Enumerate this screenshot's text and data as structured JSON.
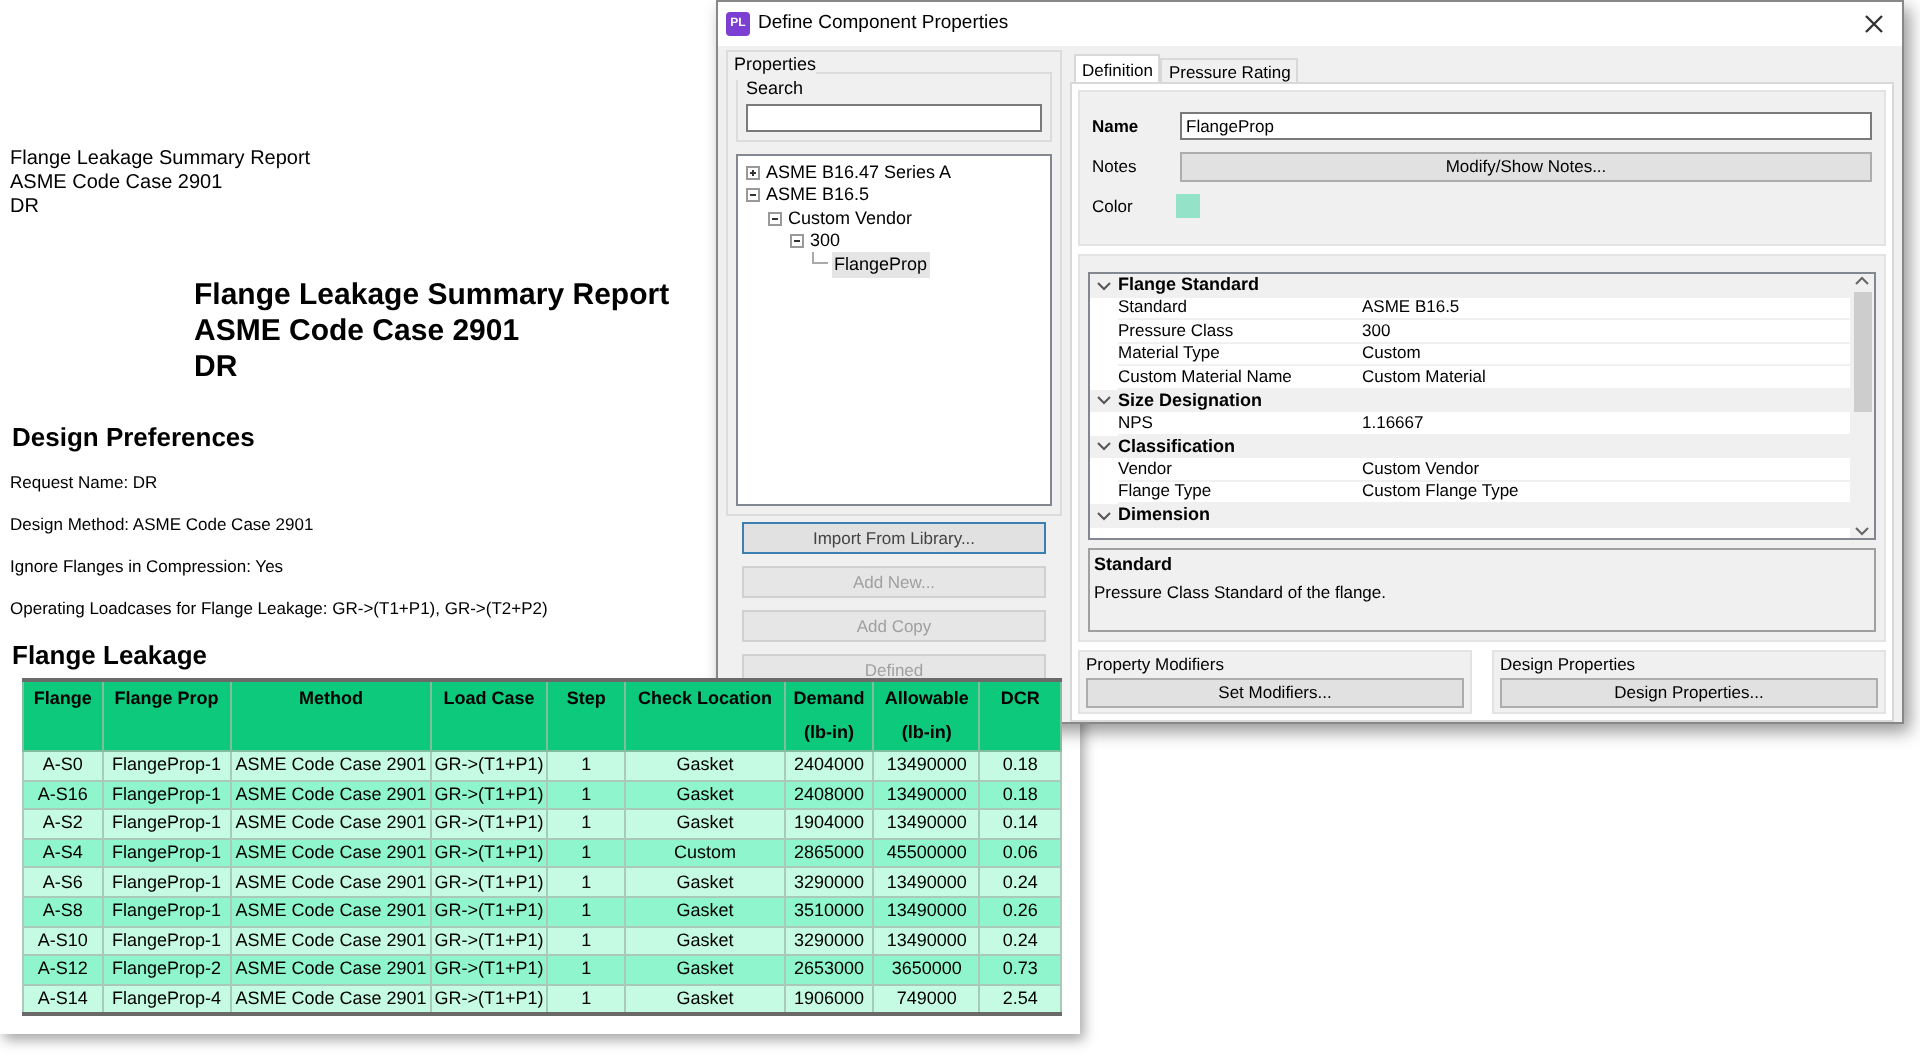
{
  "report": {
    "header_lines": [
      "Flange Leakage Summary Report",
      "ASME Code Case 2901",
      "DR"
    ],
    "title_lines": [
      "Flange Leakage Summary Report",
      "ASME Code Case 2901",
      "DR"
    ],
    "preferences_heading": "Design Preferences",
    "preferences": [
      "Request Name: DR",
      "Design Method: ASME Code Case 2901",
      "Ignore Flanges in Compression: Yes",
      "Operating Loadcases for Flange Leakage: GR->(T1+P1), GR->(T2+P2)"
    ],
    "table_heading": "Flange Leakage",
    "table": {
      "columns": [
        "Flange",
        "Flange Prop",
        "Method",
        "Load Case",
        "Step",
        "Check Location",
        "Demand (lb-in)",
        "Allowable (lb-in)",
        "DCR"
      ],
      "rows": [
        [
          "A-S0",
          "FlangeProp-1",
          "ASME Code Case 2901",
          "GR->(T1+P1)",
          "1",
          "Gasket",
          "2404000",
          "13490000",
          "0.18"
        ],
        [
          "A-S16",
          "FlangeProp-1",
          "ASME Code Case 2901",
          "GR->(T1+P1)",
          "1",
          "Gasket",
          "2408000",
          "13490000",
          "0.18"
        ],
        [
          "A-S2",
          "FlangeProp-1",
          "ASME Code Case 2901",
          "GR->(T1+P1)",
          "1",
          "Gasket",
          "1904000",
          "13490000",
          "0.14"
        ],
        [
          "A-S4",
          "FlangeProp-1",
          "ASME Code Case 2901",
          "GR->(T1+P1)",
          "1",
          "Custom",
          "2865000",
          "45500000",
          "0.06"
        ],
        [
          "A-S6",
          "FlangeProp-1",
          "ASME Code Case 2901",
          "GR->(T1+P1)",
          "1",
          "Gasket",
          "3290000",
          "13490000",
          "0.24"
        ],
        [
          "A-S8",
          "FlangeProp-1",
          "ASME Code Case 2901",
          "GR->(T1+P1)",
          "1",
          "Gasket",
          "3510000",
          "13490000",
          "0.26"
        ],
        [
          "A-S10",
          "FlangeProp-1",
          "ASME Code Case 2901",
          "GR->(T1+P1)",
          "1",
          "Gasket",
          "3290000",
          "13490000",
          "0.24"
        ],
        [
          "A-S12",
          "FlangeProp-2",
          "ASME Code Case 2901",
          "GR->(T1+P1)",
          "1",
          "Gasket",
          "2653000",
          "3650000",
          "0.73"
        ],
        [
          "A-S14",
          "FlangeProp-4",
          "ASME Code Case 2901",
          "GR->(T1+P1)",
          "1",
          "Gasket",
          "1906000",
          "749000",
          "2.54"
        ]
      ]
    }
  },
  "dialog": {
    "icon_text": "PL",
    "title": "Define Component Properties",
    "properties_group": "Properties",
    "search_label": "Search",
    "tree": [
      {
        "label": "ASME B16.47 Series A",
        "expanded": false,
        "selected": false
      },
      {
        "label": "ASME B16.5",
        "expanded": true,
        "selected": false,
        "children": [
          {
            "label": "Custom Vendor",
            "expanded": true,
            "selected": false,
            "children": [
              {
                "label": "300",
                "expanded": true,
                "selected": false,
                "children": [
                  {
                    "label": "FlangeProp",
                    "selected": true
                  }
                ]
              }
            ]
          }
        ]
      }
    ],
    "left_buttons": [
      {
        "label": "Import From Library...",
        "disabled": false
      },
      {
        "label": "Add New...",
        "disabled": true
      },
      {
        "label": "Add Copy",
        "disabled": true
      },
      {
        "label": "Defined",
        "disabled": true
      }
    ],
    "tabs": [
      {
        "label": "Definition",
        "selected": true
      },
      {
        "label": "Pressure Rating",
        "selected": false
      }
    ],
    "name_label": "Name",
    "name_value": "FlangeProp",
    "notes_label": "Notes",
    "notes_button": "Modify/Show Notes...",
    "color_label": "Color",
    "color": "#94e2c8",
    "grid": [
      {
        "label": "Flange Standard",
        "expanded": true,
        "rows": [
          [
            "Standard",
            "ASME B16.5"
          ],
          [
            "Pressure Class",
            "300"
          ],
          [
            "Material Type",
            "Custom"
          ],
          [
            "Custom Material Name",
            "Custom Material"
          ]
        ]
      },
      {
        "label": "Size Designation",
        "expanded": true,
        "rows": [
          [
            "NPS",
            "1.16667"
          ]
        ]
      },
      {
        "label": "Classification",
        "expanded": true,
        "rows": [
          [
            "Vendor",
            "Custom Vendor"
          ],
          [
            "Flange Type",
            "Custom Flange Type"
          ]
        ]
      },
      {
        "label": "Dimension",
        "expanded": true
      }
    ],
    "description": {
      "title": "Standard",
      "text": "Pressure Class Standard of the flange."
    },
    "modifiers_group": "Property Modifiers",
    "modifiers_button": "Set Modifiers...",
    "design_group": "Design Properties",
    "design_button": "Design Properties..."
  }
}
